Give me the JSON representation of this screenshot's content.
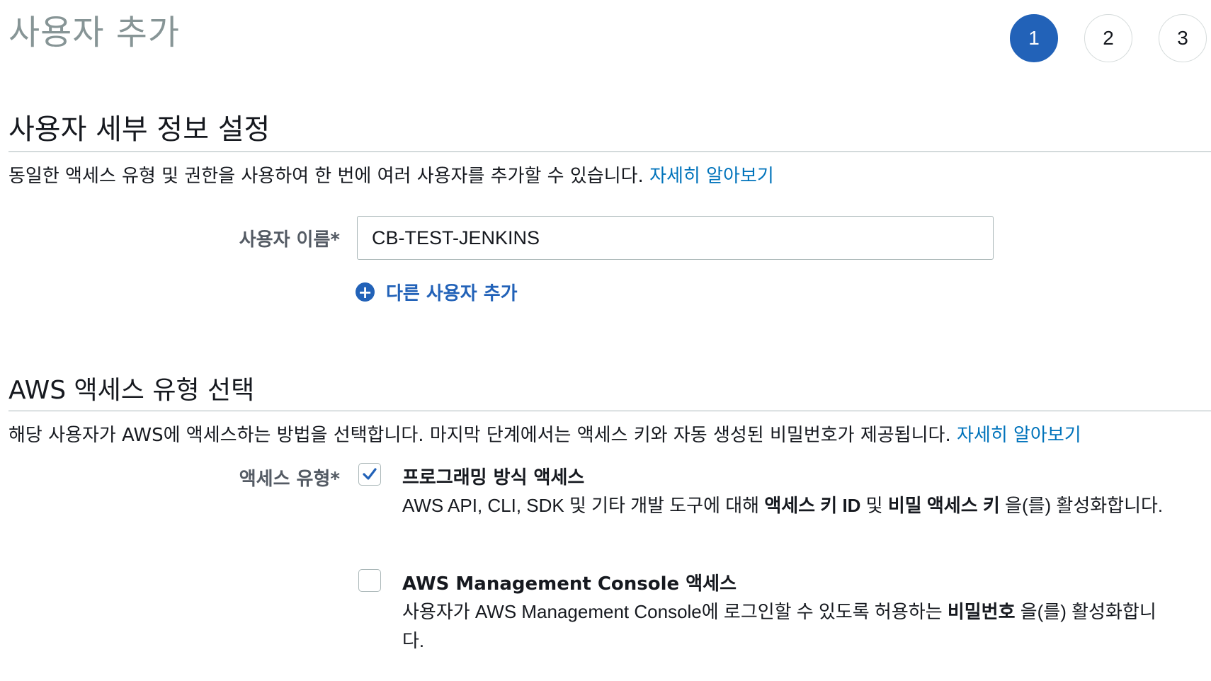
{
  "header": {
    "title": "사용자 추가",
    "steps": [
      "1",
      "2",
      "3"
    ]
  },
  "details": {
    "title": "사용자 세부 정보 설정",
    "description": "동일한 액세스 유형 및 권한을 사용하여 한 번에 여러 사용자를 추가할 수 있습니다. ",
    "learn_more": "자세히 알아보기",
    "username_label": "사용자 이름*",
    "username_value": "CB-TEST-JENKINS",
    "add_user_label": "다른 사용자 추가"
  },
  "access": {
    "title": "AWS 액세스 유형 선택",
    "description": "해당 사용자가 AWS에 액세스하는 방법을 선택합니다. 마지막 단계에서는 액세스 키와 자동 생성된 비밀번호가 제공됩니다. ",
    "learn_more": "자세히 알아보기",
    "type_label": "액세스 유형*",
    "options": [
      {
        "title": "프로그래밍 방식 액세스",
        "checked": true,
        "desc_pre": "AWS API, CLI, SDK 및 기타 개발 도구에 대해 ",
        "desc_bold1": "액세스 키 ID",
        "desc_mid": " 및 ",
        "desc_bold2": "비밀 액세스 키",
        "desc_post": " 을(를) 활성화합니다."
      },
      {
        "title": "AWS Management Console 액세스",
        "checked": false,
        "desc_pre": "사용자가 AWS Management Console에 로그인할 수 있도록 허용하는 ",
        "desc_bold1": "비밀번호",
        "desc_post": " 을(를) 활성화합니다."
      }
    ]
  },
  "colors": {
    "accent": "#2262b8",
    "link": "#0073bb",
    "border": "#aab7b8"
  }
}
